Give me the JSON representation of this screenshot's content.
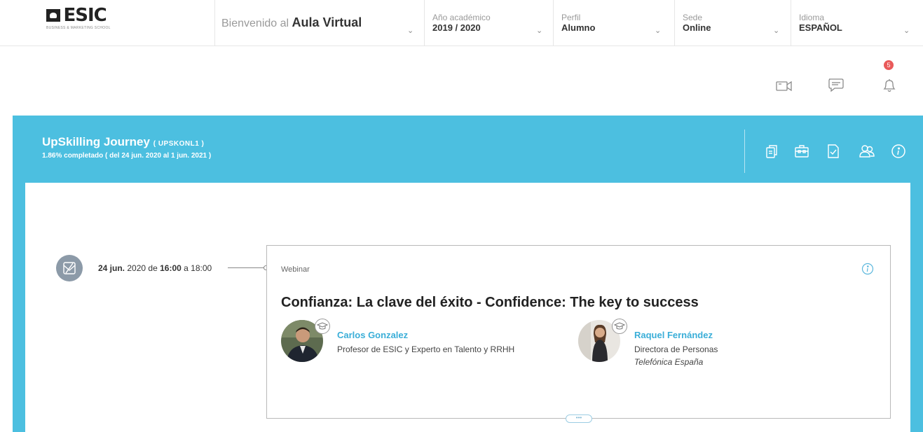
{
  "header": {
    "logo_text": "ESIC",
    "logo_sub": "BUSINESS & MARKETING SCHOOL",
    "welcome_prefix": "Bienvenido al",
    "welcome_app": "Aula Virtual",
    "selectors": [
      {
        "label": "Año académico",
        "value": "2019 / 2020"
      },
      {
        "label": "Perfil",
        "value": "Alumno"
      },
      {
        "label": "Sede",
        "value": "Online"
      },
      {
        "label": "Idioma",
        "value": "ESPAÑOL"
      }
    ]
  },
  "actions": {
    "video_icon": "video-camera-icon",
    "chat_icon": "chat-bubble-icon",
    "notifications_icon": "bell-icon",
    "notifications_count": "5"
  },
  "course": {
    "title": "UpSkilling Journey",
    "code": "( UPSKONL1 )",
    "progress_text": "1.86% completado ( del 24 jun. 2020 al 1 jun. 2021 )",
    "icons": [
      "documents-icon",
      "briefcase-icon",
      "task-check-icon",
      "group-icon",
      "info-icon"
    ]
  },
  "event": {
    "date_day": "24 jun.",
    "date_rest": "2020 de",
    "time_start": "16:00",
    "time_sep": "a",
    "time_end": "18:00",
    "type": "Webinar",
    "title": "Confianza: La clave del éxito - Confidence: The key to success",
    "more_label": "•••",
    "speakers": [
      {
        "name": "Carlos Gonzalez",
        "role": "Profesor de ESIC y Experto en Talento y RRHH",
        "company": ""
      },
      {
        "name": "Raquel Fernández",
        "role": "Directora de Personas",
        "company": "Telefónica España"
      }
    ]
  },
  "colors": {
    "accent": "#4cbfe0",
    "speaker_name": "#3aaed8",
    "badge": "#e95a5a"
  }
}
